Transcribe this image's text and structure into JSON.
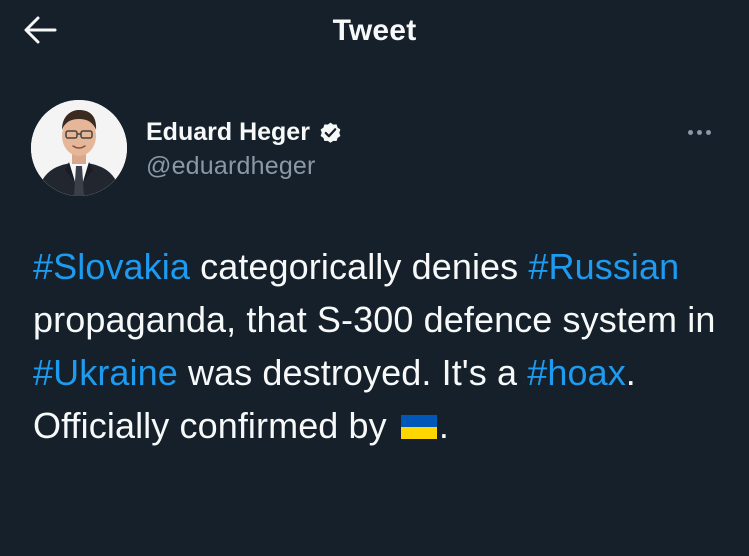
{
  "header": {
    "title": "Tweet",
    "back_icon": "arrow-left-icon"
  },
  "author": {
    "display_name": "Eduard Heger",
    "handle": "@eduardheger",
    "verified": true,
    "verified_icon": "verified-badge-icon",
    "avatar": "profile-photo"
  },
  "more_icon": "more-options-icon",
  "tweet": {
    "segments": [
      {
        "text": "#Slovakia",
        "type": "hashtag"
      },
      {
        "text": " categorically denies ",
        "type": "text"
      },
      {
        "text": "#Russian",
        "type": "hashtag"
      },
      {
        "text": " propaganda, that S-300 defence system in ",
        "type": "text"
      },
      {
        "text": "#Ukraine",
        "type": "hashtag"
      },
      {
        "text": " was destroyed. It's a ",
        "type": "text"
      },
      {
        "text": "#hoax",
        "type": "hashtag"
      },
      {
        "text": ". Officially confirmed by ",
        "type": "text"
      },
      {
        "text": ".",
        "type": "text"
      }
    ],
    "flag_icon": "ukraine-flag-emoji"
  },
  "colors": {
    "background": "#15202b",
    "text": "#f7f9f9",
    "secondary": "#8b98a5",
    "accent": "#1d9bf0"
  }
}
